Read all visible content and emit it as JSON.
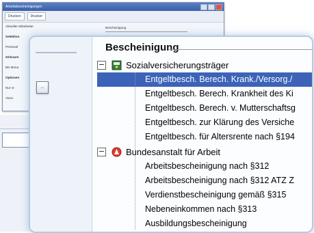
{
  "background_window": {
    "title": "Arbeitsbescheinigungen",
    "toolbar": {
      "btn1": "Drucken",
      "btn2": "Drucker"
    },
    "left": {
      "r1": "Aktueller Mitarbeiter",
      "r2": "Selektion",
      "r3": "Personal",
      "r4": "Zeitraum",
      "r5": "Bis Mona",
      "r6": "Optionen",
      "r7": "Nur re",
      "r8": "Vorsc"
    },
    "right": {
      "heading": "Bescheinigung"
    }
  },
  "small_button": {
    "label": "..."
  },
  "combo_arrow": "▼",
  "magnified": {
    "section_title": "Bescheinigung",
    "groups": [
      {
        "label": "Sozialversicherungsträger",
        "expander": "−",
        "items": [
          "Entgeltbesch. Berech. Krank./Versorg./",
          "Entgeltbesch. Berech. Krankheit des Ki",
          "Entgeltbesch. Berech. v. Mutterschaftsg",
          "Entgeltbesch. zur Klärung des Versiche",
          "Entgeltbesch. für Altersrente nach §194"
        ]
      },
      {
        "label": "Bundesanstalt für Arbeit",
        "expander": "−",
        "items": [
          "Arbeitsbescheinigung nach §312",
          "Arbeitsbescheinigung nach §312 ATZ Z",
          "Verdienstbescheinigung gemäß §315",
          "Nebeneinkommen nach §313",
          "Ausbildungsbescheinigung"
        ]
      }
    ]
  }
}
